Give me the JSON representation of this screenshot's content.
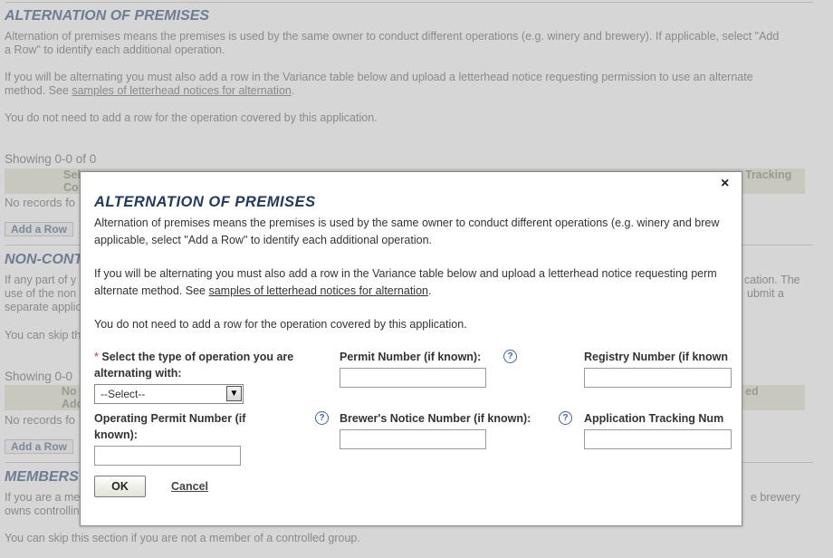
{
  "background": {
    "section1_title": "ALTERNATION OF PREMISES",
    "section1_p1": "Alternation of premises means the premises is used by the same owner to conduct different operations (e.g. winery and brewery). If applicable, select \"Add",
    "section1_p1b": "a Row\" to identify each additional operation.",
    "section1_p2": "If you will be alternating you must also add a row in the Variance table below and upload a letterhead notice requesting permission to use an alternate",
    "section1_p2b_prefix": "method. See ",
    "section1_p2b_link": "samples of letterhead notices for alternation",
    "section1_p2b_suffix": ".",
    "section1_p3": "You do not need to add a row for the operation covered by this application.",
    "showing1": "Showing 0-0 of 0",
    "table1_head_left": "Sel",
    "table1_head_left2": "Co",
    "table1_head_right": "Tracking",
    "no_records1": "No records fo",
    "add_row1": "Add a Row",
    "section2_title": "NON-CONT",
    "section2_p1a": "If any part of y",
    "section2_p1a_right": "cation. The",
    "section2_p1b": "use of the non",
    "section2_p1b_right": "ubmit a",
    "section2_p1c": "separate applic",
    "section2_p2": "You can skip th",
    "showing2": "Showing 0-0",
    "table2_head_left": "No",
    "table2_head_left2": "Adc",
    "table2_head_right": "ed",
    "no_records2": "No records fo",
    "add_row2": "Add a Row",
    "section3_title": "MEMBERS",
    "section3_p1": "If you are a me",
    "section3_p1_right": "e brewery",
    "section3_p1b": "owns controllin",
    "section3_p2": "You can skip this section if you are not a member of a controlled group."
  },
  "modal": {
    "close_glyph": "×",
    "title": "ALTERNATION OF PREMISES",
    "p1a": "Alternation of premises means the premises is used by the same owner to conduct different operations (e.g. winery and brew",
    "p1b": "applicable, select \"Add a Row\" to identify each additional operation.",
    "p2a": "If you will be alternating you must also add a row in the Variance table below and upload a letterhead notice requesting perm",
    "p2b_prefix": "alternate method. See ",
    "p2b_link": "samples of letterhead notices for alternation",
    "p2b_suffix": ".",
    "p3": "You do not need to add a row for the operation covered by this application.",
    "required_mark": "*",
    "field_operation_type_label": "Select the type of operation you are alternating with:",
    "field_operation_type_value": "--Select--",
    "field_permit_number_label": "Permit Number (if known):",
    "field_registry_number_label": "Registry Number (if known",
    "field_operating_permit_label": "Operating Permit Number (if known):",
    "field_brewers_notice_label": "Brewer's Notice Number (if known):",
    "field_tracking_label": "Application Tracking Num",
    "help_glyph": "?",
    "ok_label": "OK",
    "cancel_label": "Cancel"
  }
}
